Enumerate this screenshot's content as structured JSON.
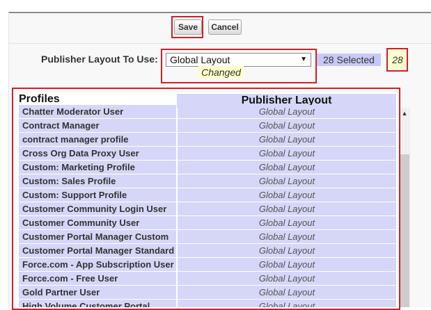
{
  "toolbar": {
    "save_label": "Save",
    "cancel_label": "Cancel"
  },
  "layout_selector": {
    "label": "Publisher Layout To Use:",
    "selected": "Global Layout",
    "changed_label": "Changed",
    "selected_count_text": "28 Selected",
    "count": "28"
  },
  "table": {
    "headers": {
      "profiles": "Profiles",
      "publisher_layout": "Publisher Layout"
    },
    "rows": [
      {
        "profile": "Chatter Moderator User",
        "layout": "Global Layout"
      },
      {
        "profile": "Contract Manager",
        "layout": "Global Layout"
      },
      {
        "profile": "contract manager profile",
        "layout": "Global Layout"
      },
      {
        "profile": "Cross Org Data Proxy User",
        "layout": "Global Layout"
      },
      {
        "profile": "Custom: Marketing Profile",
        "layout": "Global Layout"
      },
      {
        "profile": "Custom: Sales Profile",
        "layout": "Global Layout"
      },
      {
        "profile": "Custom: Support Profile",
        "layout": "Global Layout"
      },
      {
        "profile": "Customer Community Login User",
        "layout": "Global Layout"
      },
      {
        "profile": "Customer Community User",
        "layout": "Global Layout"
      },
      {
        "profile": "Customer Portal Manager Custom",
        "layout": "Global Layout"
      },
      {
        "profile": "Customer Portal Manager Standard",
        "layout": "Global Layout"
      },
      {
        "profile": "Force.com - App Subscription User",
        "layout": "Global Layout"
      },
      {
        "profile": "Force.com - Free User",
        "layout": "Global Layout"
      },
      {
        "profile": "Gold Partner User",
        "layout": "Global Layout"
      },
      {
        "profile": "High Volume Customer Portal",
        "layout": "Global Layout"
      }
    ]
  },
  "icons": {
    "select_caret": "dropdown-caret-icon",
    "scroll_up": "scroll-up-arrow-icon"
  },
  "colors": {
    "highlight": "#d01f25",
    "row_bg": "#d6d6f8",
    "changed_bg": "#ffffcc"
  }
}
